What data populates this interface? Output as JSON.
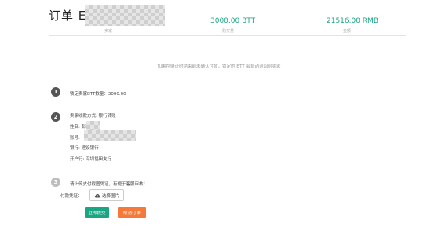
{
  "header": {
    "order_title": "订单 E",
    "stats": [
      {
        "label": "卖家",
        "value": "",
        "value_color": "#333333"
      },
      {
        "label": "购买量",
        "value": "3000.00 BTT",
        "value_color": "#1aa583"
      },
      {
        "label": "金额",
        "value": "21516.00 RMB",
        "value_color": "#1aa583"
      }
    ]
  },
  "notice": "如果在倒计时结束前未确认付款，锁定的 BTT 会自动退回给卖家",
  "steps": [
    {
      "number": "1",
      "lines": [
        "锁定卖家BTT数量：3000.00"
      ]
    },
    {
      "number": "2",
      "lines": [
        "卖家收款方式: 银行转账",
        "姓名: 彭",
        "账号:",
        "银行: 建设银行",
        "开户行: 深圳福田支行"
      ]
    },
    {
      "number": "3",
      "lines": [
        "请上传支付截图凭证，有便于客服审核！"
      ]
    }
  ],
  "upload": {
    "label": "付款凭证：",
    "button_label": "选择图片",
    "icon": "cloud-upload-icon"
  },
  "actions": {
    "submit_label": "立即提交",
    "cancel_label": "取消订单"
  },
  "colors": {
    "accent_green": "#1aa583",
    "accent_orange": "#f57a3a",
    "step_circle": "#555555",
    "step_circle_inactive": "#bdbdbd"
  }
}
